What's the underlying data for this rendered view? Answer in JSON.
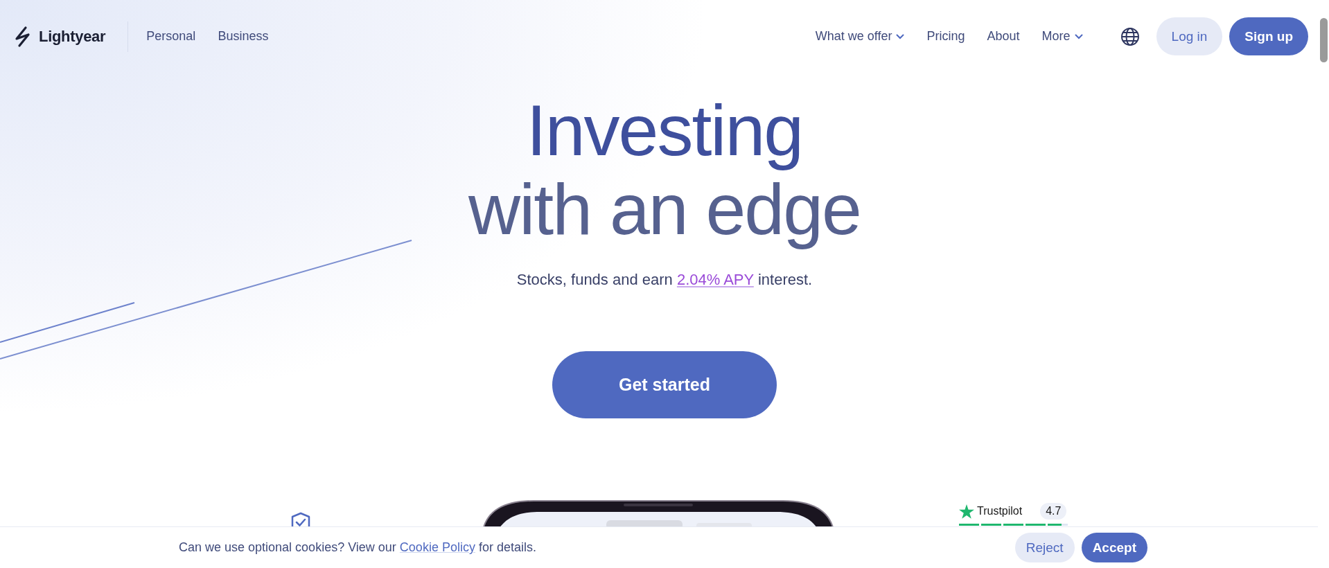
{
  "header": {
    "logo": "Lightyear",
    "segments": [
      {
        "label": "Personal",
        "selected": false
      },
      {
        "label": "Business",
        "selected": false
      }
    ],
    "nav": [
      {
        "label": "What we offer",
        "kind": "dropdown"
      },
      {
        "label": "Pricing",
        "kind": "link"
      },
      {
        "label": "About",
        "kind": "link"
      },
      {
        "label": "More",
        "kind": "dropdown"
      }
    ],
    "login": "Log in",
    "signup": "Sign up"
  },
  "hero": {
    "title_lines": [
      "Investing",
      "with an edge"
    ],
    "subtitle_before": "Stocks, funds and earn ",
    "subtitle_link": "2.04% APY",
    "subtitle_after": " interest.",
    "cta": "Get started"
  },
  "trustpilot": {
    "brand": "Trustpilot",
    "rating": "4.7",
    "stars": 4.7
  },
  "cookie_bar": {
    "text_before": "Can we use optional cookies? View our ",
    "link": "Cookie Policy",
    "text_after": " for details.",
    "buttons": [
      {
        "label": "Reject",
        "kind": "secondary"
      },
      {
        "label": "Accept",
        "kind": "primary"
      }
    ]
  }
}
